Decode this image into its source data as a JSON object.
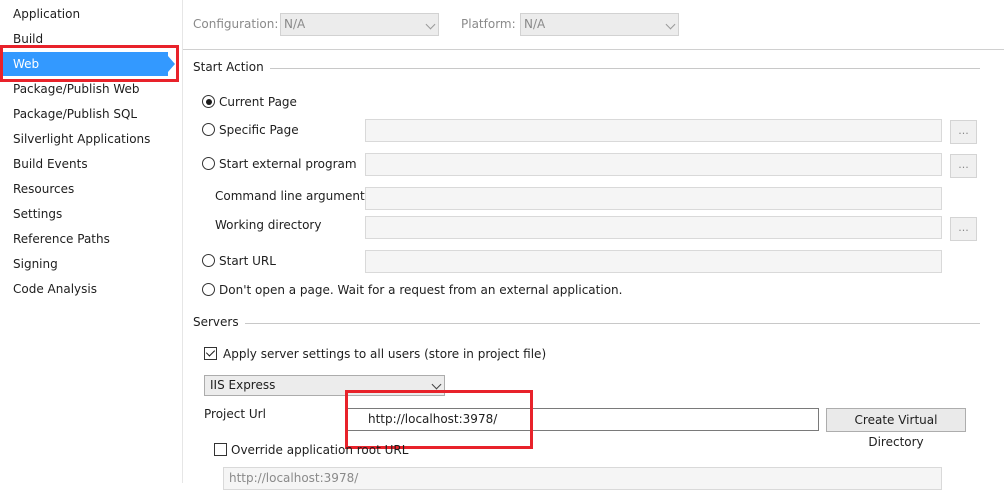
{
  "sidebar": {
    "items": [
      {
        "label": "Application"
      },
      {
        "label": "Build"
      },
      {
        "label": "Web",
        "selected": true
      },
      {
        "label": "Package/Publish Web"
      },
      {
        "label": "Package/Publish SQL"
      },
      {
        "label": "Silverlight Applications"
      },
      {
        "label": "Build Events"
      },
      {
        "label": "Resources"
      },
      {
        "label": "Settings"
      },
      {
        "label": "Reference Paths"
      },
      {
        "label": "Signing"
      },
      {
        "label": "Code Analysis"
      }
    ],
    "selected_color": "#3399ff"
  },
  "toolbar": {
    "configuration_label": "Configuration:",
    "configuration_value": "N/A",
    "platform_label": "Platform:",
    "platform_value": "N/A"
  },
  "start_action": {
    "heading": "Start Action",
    "current_page": "Current Page",
    "specific_page": "Specific Page",
    "start_external_program": "Start external program",
    "command_line_arguments": "Command line arguments",
    "working_directory": "Working directory",
    "start_url": "Start URL",
    "dont_open": "Don't open a page.  Wait for a request from an external application.",
    "browse_label": "...",
    "selected": "current_page"
  },
  "servers": {
    "heading": "Servers",
    "apply_to_all": "Apply server settings to all users (store in project file)",
    "apply_checked": true,
    "server_value": "IIS Express",
    "project_url_label": "Project Url",
    "project_url_value": "http://localhost:3978/",
    "create_virtual_directory": "Create Virtual Directory",
    "override_root": "Override application root URL",
    "override_checked": false,
    "override_value": "http://localhost:3978/"
  },
  "highlight_color": "#e8222a"
}
